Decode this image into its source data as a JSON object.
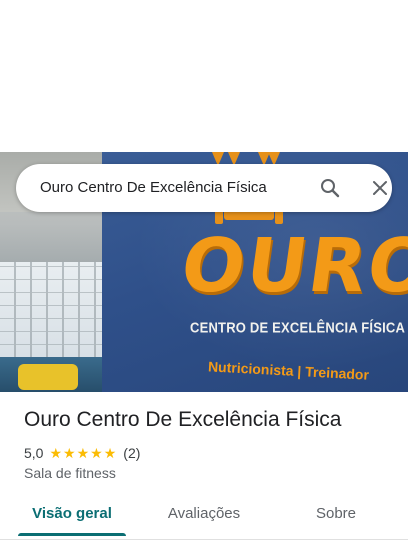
{
  "search": {
    "query": "Ouro Centro De Excelência Física"
  },
  "hero": {
    "logo_main": "OURO",
    "logo_sub": "CENTRO DE EXCELÊNCIA FÍSICA",
    "logo_sub2": "Nutricionista | Treinador"
  },
  "place": {
    "title": "Ouro Centro De Excelência Física",
    "rating": "5,0",
    "stars": 5,
    "review_count": "(2)",
    "category": "Sala de fitness"
  },
  "tabs": [
    {
      "label": "Visão geral",
      "active": true
    },
    {
      "label": "Avaliações",
      "active": false
    },
    {
      "label": "Sobre",
      "active": false
    }
  ],
  "colors": {
    "accent": "#0b6e73",
    "star": "#fbbc04",
    "logo_orange": "#f39a17"
  },
  "icons": [
    "search-icon",
    "close-icon",
    "star-icon"
  ]
}
